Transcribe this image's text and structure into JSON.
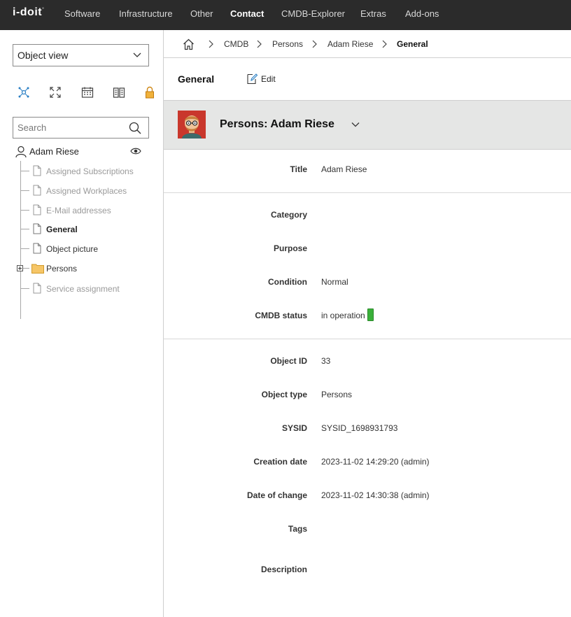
{
  "topnav": {
    "logo": "i-doit",
    "items": [
      "Software",
      "Infrastructure",
      "Other",
      "Contact",
      "CMDB-Explorer",
      "Extras",
      "Add-ons"
    ],
    "active": "Contact"
  },
  "sidebar": {
    "view_select": "Object view",
    "tool_icons": [
      "relations-icon",
      "fullscreen-icon",
      "calendar-icon",
      "book-icon",
      "lock-icon"
    ],
    "search": {
      "placeholder": "Search",
      "value": ""
    },
    "tree": {
      "root": "Adam Riese",
      "items": [
        {
          "label": "Assigned Subscriptions",
          "style": "disabled"
        },
        {
          "label": "Assigned Workplaces",
          "style": "disabled"
        },
        {
          "label": "E-Mail addresses",
          "style": "disabled"
        },
        {
          "label": "General",
          "style": "active"
        },
        {
          "label": "Object picture",
          "style": "normal"
        },
        {
          "label": "Persons",
          "style": "folder"
        },
        {
          "label": "Service assignment",
          "style": "disabled"
        }
      ]
    }
  },
  "breadcrumb": [
    "CMDB",
    "Persons",
    "Adam Riese",
    "General"
  ],
  "page": {
    "title": "General",
    "edit_label": "Edit"
  },
  "object": {
    "title": "Persons: Adam Riese"
  },
  "fields": {
    "title": {
      "label": "Title",
      "value": "Adam Riese"
    },
    "category": {
      "label": "Category",
      "value": ""
    },
    "purpose": {
      "label": "Purpose",
      "value": ""
    },
    "condition": {
      "label": "Condition",
      "value": "Normal"
    },
    "cmdb_status": {
      "label": "CMDB status",
      "value": "in operation",
      "color": "#3ab03a"
    },
    "object_id": {
      "label": "Object ID",
      "value": "33"
    },
    "object_type": {
      "label": "Object type",
      "value": "Persons"
    },
    "sysid": {
      "label": "SYSID",
      "value": "SYSID_1698931793"
    },
    "creation_date": {
      "label": "Creation date",
      "value": "2023-11-02 14:29:20 (admin)"
    },
    "date_of_change": {
      "label": "Date of change",
      "value": "2023-11-02 14:30:38 (admin)"
    },
    "tags": {
      "label": "Tags",
      "value": ""
    },
    "description": {
      "label": "Description",
      "value": ""
    }
  }
}
